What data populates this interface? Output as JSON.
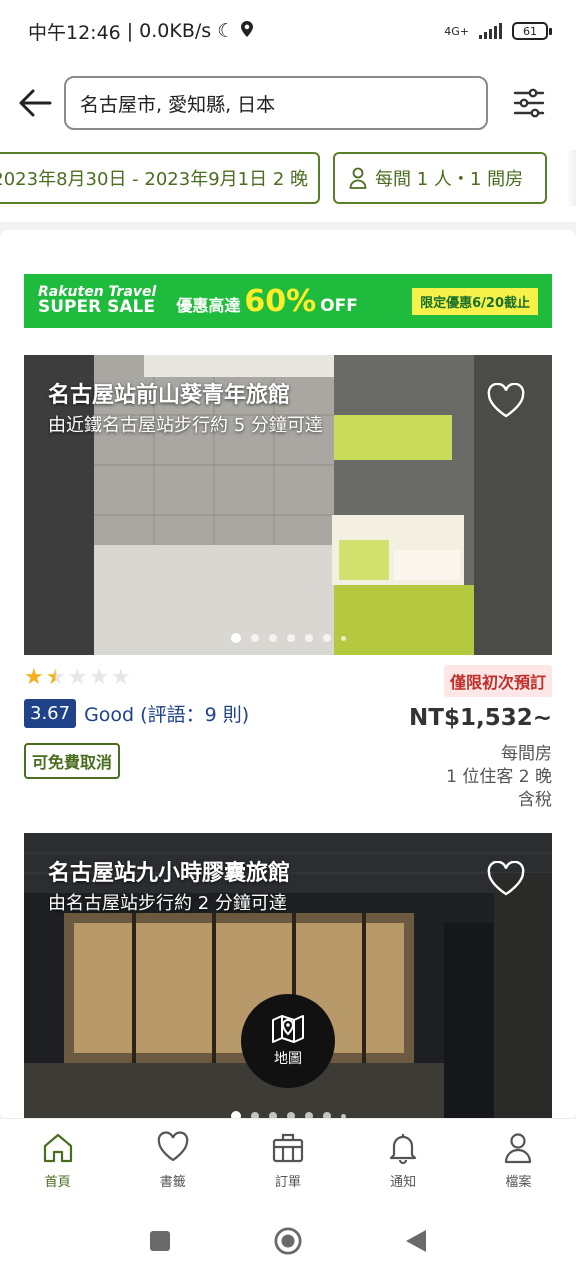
{
  "status_bar": {
    "time": "中午12:46",
    "network_speed": "0.0KB/s",
    "network_type": "4G+",
    "battery": "61"
  },
  "header": {
    "back_icon": "arrow-left-icon",
    "search_value": "名古屋市, 愛知縣, 日本",
    "filter_icon": "sliders-icon"
  },
  "chips": {
    "dates": "2023年8月30日 - 2023年9月1日 2 晚",
    "guests": "每間 1 人・1 間房",
    "guests_icon": "person-icon"
  },
  "promo_banner": {
    "brand_line1": "Rakuten Travel",
    "brand_line2": "SUPER SALE",
    "lead": "優惠高達",
    "percent": "60%",
    "off": "OFF",
    "tag": "限定優惠6/20截止",
    "color": "#1fbb3d"
  },
  "hotels": [
    {
      "name": "名古屋站前山葵青年旅館",
      "access": "由近鐵名古屋站步行約 5 分鐘可達",
      "stars": 1.5,
      "score": "3.67",
      "rating_text": "Good (評語：9 則)",
      "free_cancel": "可免費取消",
      "promo_badge": "僅限初次預訂",
      "price": "NT$1,532~",
      "price_note_1": "每間房",
      "price_note_2": "1 位住客 2 晚",
      "price_note_3": "含稅"
    },
    {
      "name": "名古屋站九小時膠囊旅館",
      "access": "由名古屋站步行約 2 分鐘可達"
    }
  ],
  "map_button": {
    "label": "地圖",
    "icon": "map-icon"
  },
  "bottom_nav": [
    {
      "label": "首頁",
      "icon": "home-icon"
    },
    {
      "label": "書籤",
      "icon": "heart-icon"
    },
    {
      "label": "訂單",
      "icon": "briefcase-icon"
    },
    {
      "label": "通知",
      "icon": "bell-icon"
    },
    {
      "label": "檔案",
      "icon": "profile-icon"
    }
  ],
  "colors": {
    "accent_green": "#4b6d1f",
    "score_blue": "#1f4288",
    "promo_red": "#c0302a"
  }
}
